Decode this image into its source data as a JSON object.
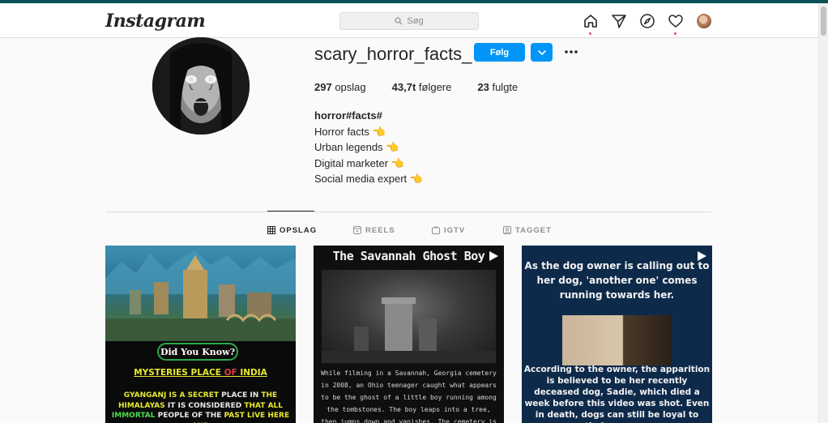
{
  "navbar": {
    "logo": "Instagram",
    "search_placeholder": "Søg"
  },
  "profile": {
    "username": "scary_horror_facts_",
    "follow_label": "Følg",
    "stats": [
      {
        "value": "297",
        "label": "opslag"
      },
      {
        "value": "43,7t",
        "label": "følgere"
      },
      {
        "value": "23",
        "label": "fulgte"
      }
    ],
    "bio": {
      "name": "horror#facts#",
      "lines": [
        "Horror facts",
        "Urban legends",
        "Digital marketer",
        "Social media expert"
      ],
      "emoji": "👈"
    }
  },
  "tabs": [
    {
      "label": "OPSLAG",
      "icon": "grid-icon"
    },
    {
      "label": "REELS",
      "icon": "reels-icon"
    },
    {
      "label": "IGTV",
      "icon": "igtv-icon"
    },
    {
      "label": "TAGGET",
      "icon": "tagged-icon"
    }
  ],
  "posts": {
    "p1": {
      "badge": "Did You Know?",
      "head_a": "MYSTERIES PLACE ",
      "head_b": "OF ",
      "head_c": "INDIA",
      "t1": "GYANGANJ IS A SECRET",
      "t2": " PLACE IN ",
      "t3": "THE",
      "t4": "HIMALAYAS",
      "t5": " IT IS CONSIDERED ",
      "t6": "THAT ALL",
      "t7": "IMMORTAL",
      "t8": " PEOPLE OF THE ",
      "t9": "PAST LIVE HERE AND"
    },
    "p2": {
      "title": "The Savannah Ghost Boy",
      "text": "While filming in a Savannah, Georgia cemetery in 2008, an Ohio teenager caught what appears to be the ghost of a little boy running among the tombstones. The boy leaps into a tree, then jumps down and vanishes. The cemetery is home to a mass grave of women"
    },
    "p3": {
      "top": "As the dog owner is calling out to her dog, 'another one' comes running towards her.",
      "bottom": "According to the owner, the apparition is believed to be her recently deceased dog, Sadie, which died a week before this video was shot. Even in death, dogs can still be loyal to their owners."
    }
  },
  "colors": {
    "accent": "#0095f6",
    "notification": "#ed4956",
    "top_strip": "#0d5057"
  }
}
